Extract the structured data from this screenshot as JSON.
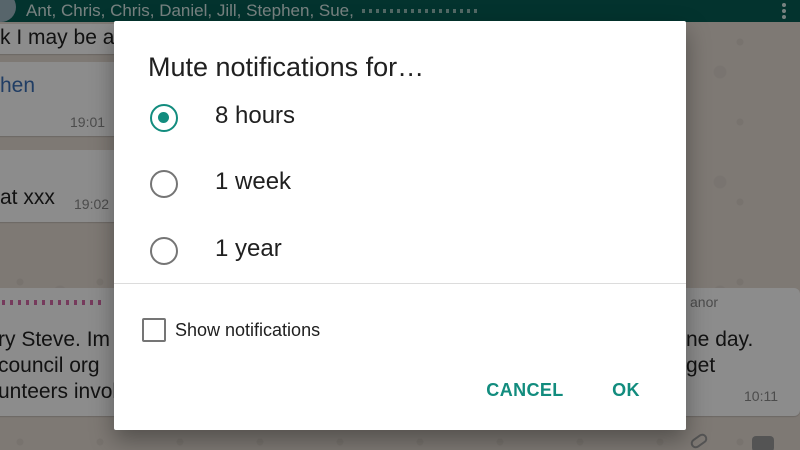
{
  "background": {
    "group_members": "Ant, Chris, Chris, Daniel, Jill, Stephen, Sue,",
    "messages": [
      {
        "text": "k I may be a",
        "time": ""
      },
      {
        "text": "hen",
        "time": "19:01"
      },
      {
        "text": "at xxx",
        "time": "19:02"
      },
      {
        "lines": [
          "ry Steve. Im",
          "council org",
          "unteers invol"
        ],
        "time": ""
      },
      {
        "sender": "anor",
        "lines": [
          "ne day.",
          "get"
        ],
        "time": "10:11"
      }
    ]
  },
  "dialog": {
    "title": "Mute notifications for…",
    "options": [
      {
        "label": "8 hours",
        "selected": true
      },
      {
        "label": "1 week",
        "selected": false
      },
      {
        "label": "1 year",
        "selected": false
      }
    ],
    "show_notifications": {
      "label": "Show notifications",
      "checked": false
    },
    "buttons": {
      "cancel": "CANCEL",
      "ok": "OK"
    }
  },
  "colors": {
    "accent": "#128c7e",
    "toolbar": "#075e54",
    "scrim": "rgba(0,0,0,0.45)"
  }
}
